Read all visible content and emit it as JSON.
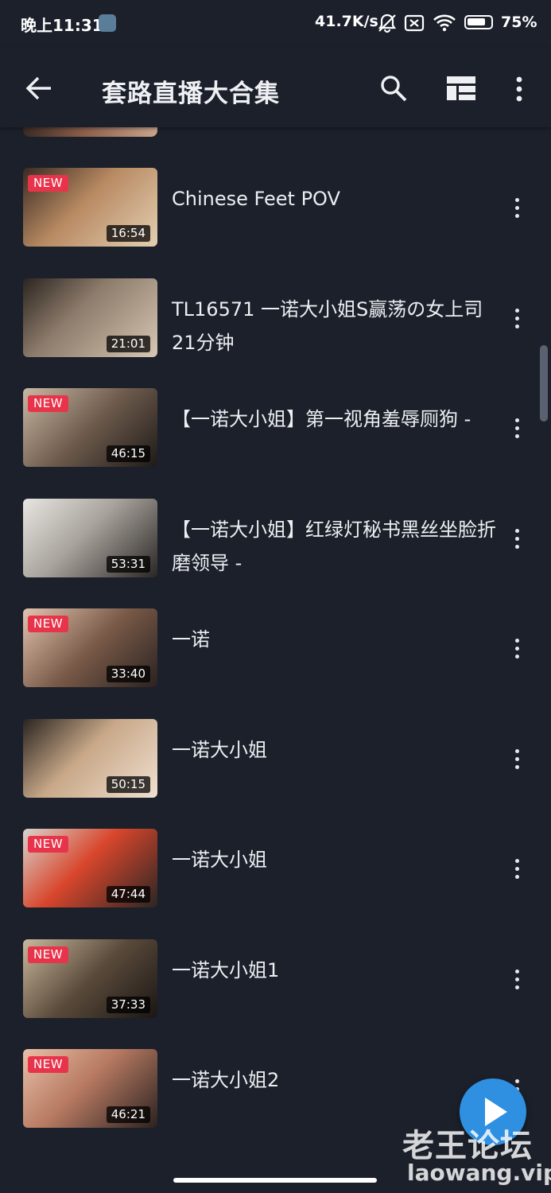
{
  "status_bar": {
    "time": "晚上11:31",
    "net_speed": "41.7K/s",
    "battery": "75%",
    "icons": [
      "app-badge-icon",
      "mute-bell-icon",
      "sim-off-icon",
      "wifi-icon",
      "battery-icon"
    ]
  },
  "app_bar": {
    "title": "套路直播大合集",
    "icons": [
      "back-arrow-icon",
      "search-icon",
      "layout-grid-icon",
      "more-vertical-icon"
    ]
  },
  "colors": {
    "background": "#1b202b",
    "new_badge": "#e8344a",
    "fab": "#2f8fe0"
  },
  "videos": [
    {
      "title": "Chinese Feet POV",
      "duration": "16:54",
      "is_new": true,
      "new_label": "NEW"
    },
    {
      "title": "TL16571 一诺大小姐S赢荡の女上司21分钟",
      "duration": "21:01",
      "is_new": false,
      "new_label": ""
    },
    {
      "title": "【一诺大小姐】第一视角羞辱厕狗 -",
      "duration": "46:15",
      "is_new": true,
      "new_label": "NEW"
    },
    {
      "title": "【一诺大小姐】红绿灯秘书黑丝坐脸折磨领导 -",
      "duration": "53:31",
      "is_new": false,
      "new_label": ""
    },
    {
      "title": "一诺",
      "duration": "33:40",
      "is_new": true,
      "new_label": "NEW"
    },
    {
      "title": "一诺大小姐",
      "duration": "50:15",
      "is_new": false,
      "new_label": ""
    },
    {
      "title": "一诺大小姐",
      "duration": "47:44",
      "is_new": true,
      "new_label": "NEW"
    },
    {
      "title": "一诺大小姐1",
      "duration": "37:33",
      "is_new": true,
      "new_label": "NEW"
    },
    {
      "title": "一诺大小姐2",
      "duration": "46:21",
      "is_new": true,
      "new_label": "NEW"
    }
  ],
  "fab": {
    "icon": "play-icon"
  },
  "watermark": {
    "cn": "老王论坛",
    "en": "laowang.vip"
  }
}
